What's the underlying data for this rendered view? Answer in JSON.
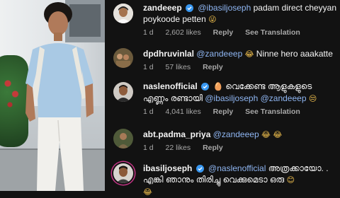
{
  "photo": {
    "alt": "man in light blue t-shirt and white pants"
  },
  "comments": [
    {
      "username": "zandeeep",
      "verified": true,
      "mention": "@ibasiljoseph",
      "text": "padam direct cheyyan",
      "text2": "poykoode petten",
      "emoji": "😜",
      "time": "1 d",
      "likes": "2,602 likes",
      "reply": "Reply",
      "translate": "See Translation",
      "avatar_icon": "profile-photo-man-with-cap"
    },
    {
      "username": "dpdhruvinlal",
      "verified": false,
      "mention": "@zandeeep",
      "emoji": "😂",
      "text": "Ninne hero aaakatte",
      "time": "1 d",
      "likes": "57 likes",
      "reply": "Reply",
      "avatar_icon": "profile-photo-group"
    },
    {
      "username": "naslenofficial",
      "verified": true,
      "emoji": "🥚",
      "text": "വെക്കേണ്ട ആളുകളുടെ",
      "text2a": "എണ്ണം രണ്ടായി",
      "mention": "@ibasiljoseph",
      "mention2": "@zandeeep",
      "emoji2": "😒",
      "time": "1 d",
      "likes": "4,041 likes",
      "reply": "Reply",
      "translate": "See Translation",
      "avatar_icon": "profile-photo-man"
    },
    {
      "username": "abt.padma_priya",
      "verified": false,
      "mention": "@zandeeep",
      "emoji": "😂 😂",
      "time": "1 d",
      "likes": "22 likes",
      "reply": "Reply",
      "avatar_icon": "profile-photo-outdoor"
    },
    {
      "username": "ibasiljoseph",
      "verified": true,
      "mention": "@naslenofficial",
      "text": "അത്രക്കായോ. .",
      "text2": "എങ്കി ഞാനും തിരിച്ചു വെക്കുമെടാ ഒരു",
      "emoji": "😊",
      "emoji3": "😂",
      "avatar_icon": "profile-photo-man-with-story-ring"
    }
  ],
  "colors": {
    "background": "#121212",
    "mention": "#8fb6f2",
    "verified": "#3897f0",
    "meta": "#a8a8a8"
  }
}
